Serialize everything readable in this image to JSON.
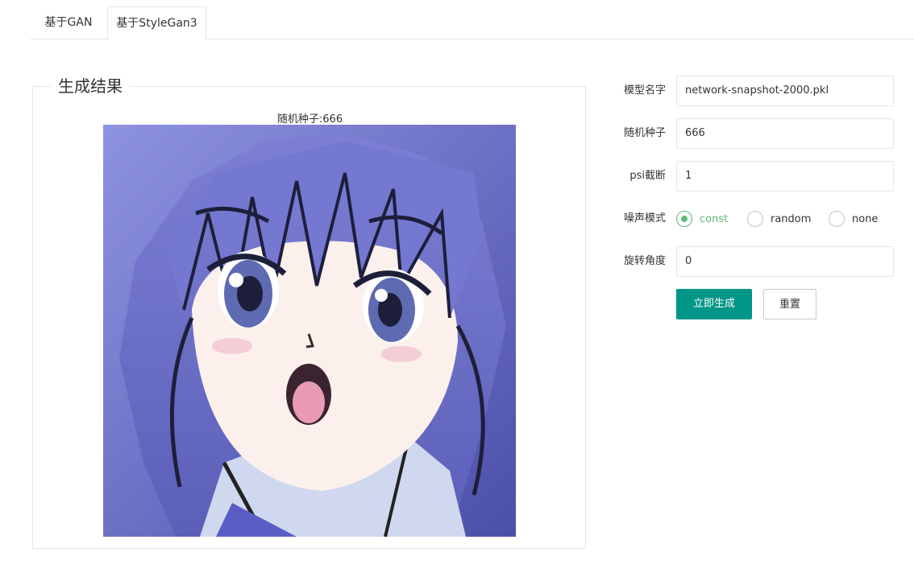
{
  "tabs": [
    {
      "label": "基于GAN",
      "active": false
    },
    {
      "label": "基于StyleGan3",
      "active": true
    }
  ],
  "result": {
    "legend": "生成结果",
    "caption": "随机种子:666"
  },
  "form": {
    "model_name": {
      "label": "模型名字",
      "value": "network-snapshot-2000.pkl"
    },
    "seed": {
      "label": "随机种子",
      "value": "666"
    },
    "psi": {
      "label": "psi截断",
      "value": "1"
    },
    "noise_mode": {
      "label": "噪声模式",
      "options": [
        {
          "label": "const",
          "checked": true
        },
        {
          "label": "random",
          "checked": false
        },
        {
          "label": "none",
          "checked": false
        }
      ]
    },
    "rotation": {
      "label": "旋转角度",
      "value": "0"
    },
    "submit_label": "立即生成",
    "reset_label": "重置"
  },
  "colors": {
    "primary": "#009688",
    "radio_checked": "#5fb878",
    "border": "#e6e6e6"
  }
}
